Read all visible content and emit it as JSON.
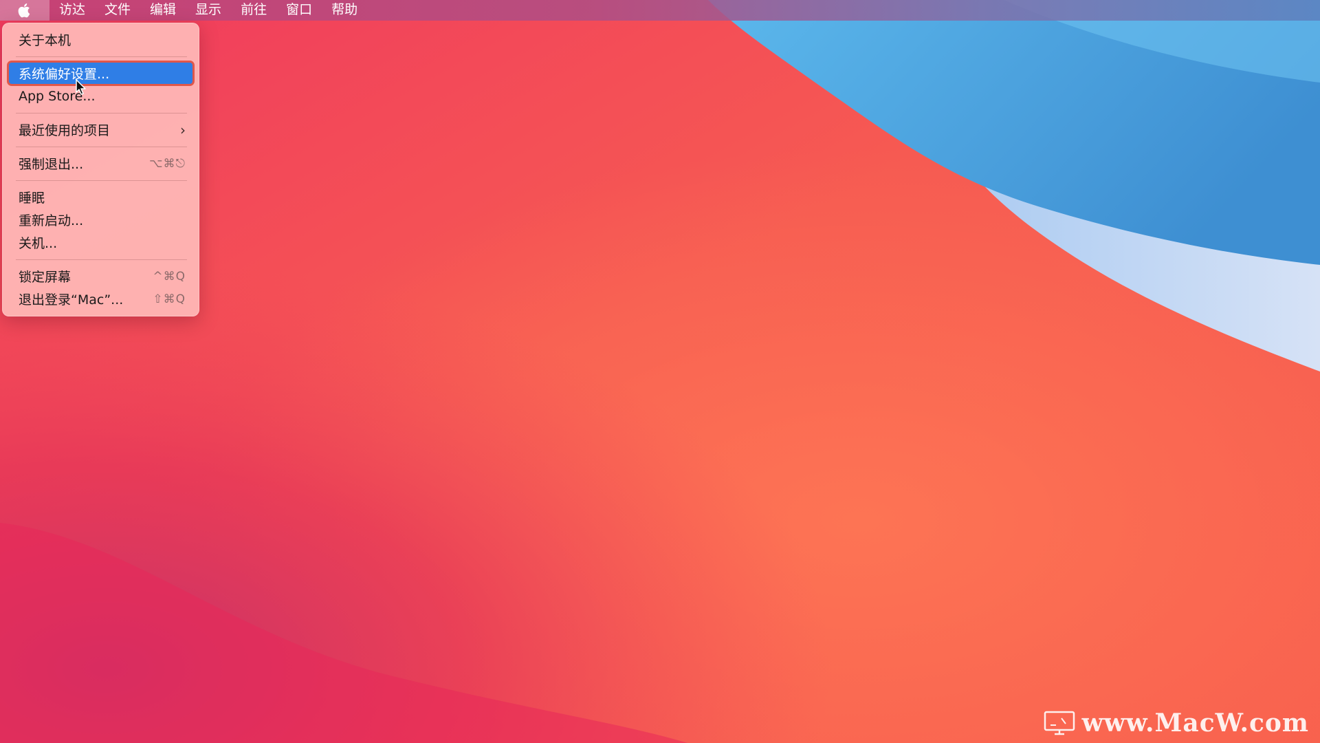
{
  "menubar": {
    "apple_icon": "apple-logo-icon",
    "items": [
      {
        "label": "访达"
      },
      {
        "label": "文件"
      },
      {
        "label": "编辑"
      },
      {
        "label": "显示"
      },
      {
        "label": "前往"
      },
      {
        "label": "窗口"
      },
      {
        "label": "帮助"
      }
    ]
  },
  "apple_menu": {
    "about": {
      "label": "关于本机"
    },
    "system_prefs": {
      "label": "系统偏好设置..."
    },
    "app_store": {
      "label": "App Store..."
    },
    "recent_items": {
      "label": "最近使用的项目",
      "icon": "chevron-right-icon"
    },
    "force_quit": {
      "label": "强制退出...",
      "shortcut": "⌥⌘⎋"
    },
    "sleep": {
      "label": "睡眠"
    },
    "restart": {
      "label": "重新启动..."
    },
    "shutdown": {
      "label": "关机..."
    },
    "lock_screen": {
      "label": "锁定屏幕",
      "shortcut": "^⌘Q"
    },
    "log_out": {
      "label": "退出登录“Mac”...",
      "shortcut": "⇧⌘Q"
    }
  },
  "watermark": {
    "text": "www.MacW.com"
  },
  "colors": {
    "highlight": "#2f7ee6",
    "highlight_outline": "#e0574a",
    "wallpaper_red": "#f35a4f",
    "wallpaper_blue": "#4aa3e0"
  }
}
